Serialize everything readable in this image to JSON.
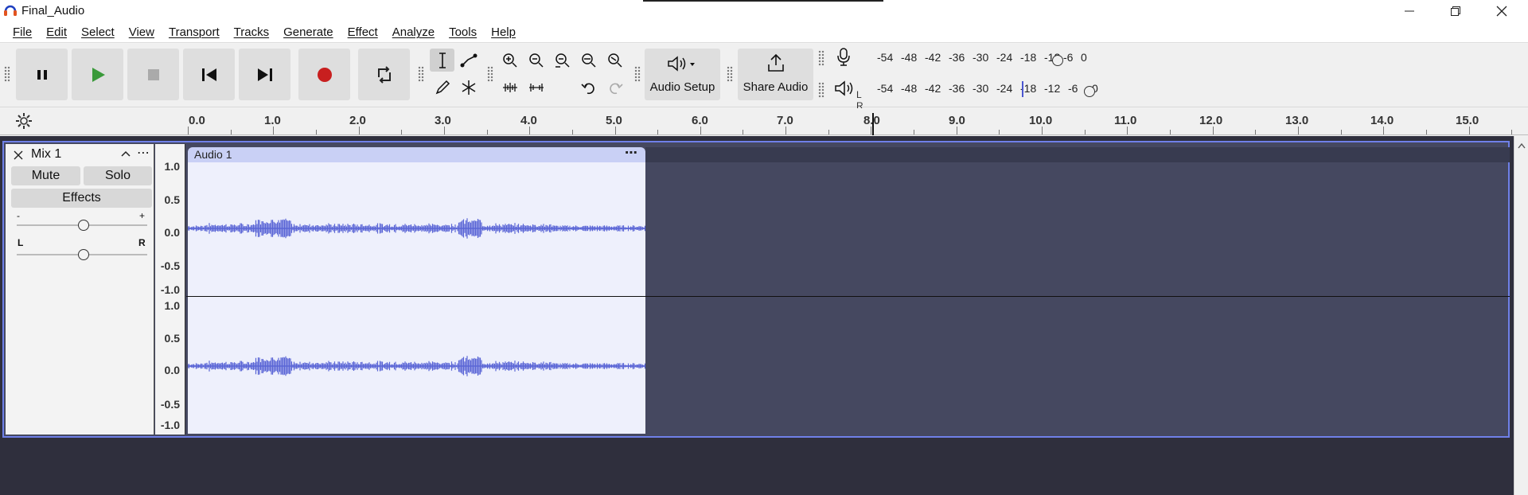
{
  "window": {
    "title": "Final_Audio"
  },
  "menu": [
    "File",
    "Edit",
    "Select",
    "View",
    "Transport",
    "Tracks",
    "Generate",
    "Effect",
    "Analyze",
    "Tools",
    "Help"
  ],
  "toolbar": {
    "audio_setup_label": "Audio Setup",
    "share_audio_label": "Share Audio"
  },
  "meters": {
    "record_scale": [
      "-54",
      "-48",
      "-42",
      "-36",
      "-30",
      "-24",
      "-18",
      "-12",
      "-6",
      "0"
    ],
    "playback_scale": [
      "-54",
      "-48",
      "-42",
      "-36",
      "-30",
      "-24",
      "-18",
      "-12",
      "-6",
      "0"
    ],
    "left_label": "L",
    "right_label": "R"
  },
  "ruler": {
    "labels": [
      "0.0",
      "1.0",
      "2.0",
      "3.0",
      "4.0",
      "5.0",
      "6.0",
      "7.0",
      "8.0",
      "9.0",
      "10.0",
      "11.0",
      "12.0",
      "13.0",
      "14.0",
      "15.0"
    ]
  },
  "track": {
    "name": "Mix 1",
    "mute_label": "Mute",
    "solo_label": "Solo",
    "effects_label": "Effects",
    "gain_min": "-",
    "gain_max": "+",
    "pan_left": "L",
    "pan_right": "R",
    "clip_name": "Audio 1",
    "vruler_top": [
      "1.0",
      "0.5",
      "0.0",
      "-0.5",
      "-1.0"
    ],
    "vruler_bottom": [
      "1.0",
      "0.5",
      "0.0",
      "-0.5",
      "-1.0"
    ]
  },
  "colors": {
    "accent": "#6f80e8",
    "waveform": "#5b66d6",
    "record": "#c81f1f",
    "play": "#3a9a3a"
  }
}
